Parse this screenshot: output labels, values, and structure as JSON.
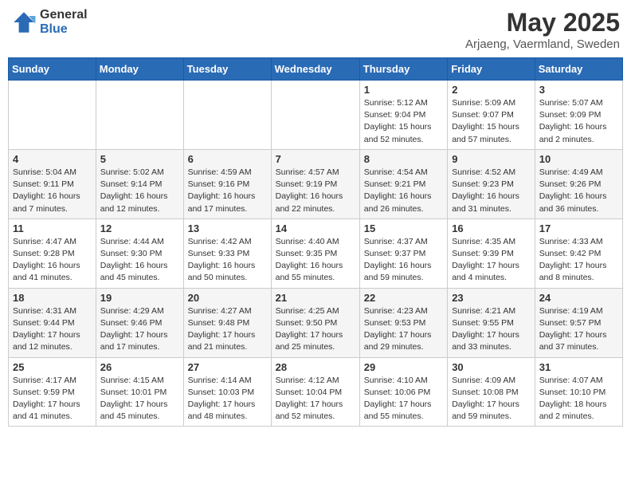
{
  "header": {
    "logo_general": "General",
    "logo_blue": "Blue",
    "title": "May 2025",
    "subtitle": "Arjaeng, Vaermland, Sweden"
  },
  "days_of_week": [
    "Sunday",
    "Monday",
    "Tuesday",
    "Wednesday",
    "Thursday",
    "Friday",
    "Saturday"
  ],
  "weeks": [
    [
      {
        "day": "",
        "info": ""
      },
      {
        "day": "",
        "info": ""
      },
      {
        "day": "",
        "info": ""
      },
      {
        "day": "",
        "info": ""
      },
      {
        "day": "1",
        "info": "Sunrise: 5:12 AM\nSunset: 9:04 PM\nDaylight: 15 hours\nand 52 minutes."
      },
      {
        "day": "2",
        "info": "Sunrise: 5:09 AM\nSunset: 9:07 PM\nDaylight: 15 hours\nand 57 minutes."
      },
      {
        "day": "3",
        "info": "Sunrise: 5:07 AM\nSunset: 9:09 PM\nDaylight: 16 hours\nand 2 minutes."
      }
    ],
    [
      {
        "day": "4",
        "info": "Sunrise: 5:04 AM\nSunset: 9:11 PM\nDaylight: 16 hours\nand 7 minutes."
      },
      {
        "day": "5",
        "info": "Sunrise: 5:02 AM\nSunset: 9:14 PM\nDaylight: 16 hours\nand 12 minutes."
      },
      {
        "day": "6",
        "info": "Sunrise: 4:59 AM\nSunset: 9:16 PM\nDaylight: 16 hours\nand 17 minutes."
      },
      {
        "day": "7",
        "info": "Sunrise: 4:57 AM\nSunset: 9:19 PM\nDaylight: 16 hours\nand 22 minutes."
      },
      {
        "day": "8",
        "info": "Sunrise: 4:54 AM\nSunset: 9:21 PM\nDaylight: 16 hours\nand 26 minutes."
      },
      {
        "day": "9",
        "info": "Sunrise: 4:52 AM\nSunset: 9:23 PM\nDaylight: 16 hours\nand 31 minutes."
      },
      {
        "day": "10",
        "info": "Sunrise: 4:49 AM\nSunset: 9:26 PM\nDaylight: 16 hours\nand 36 minutes."
      }
    ],
    [
      {
        "day": "11",
        "info": "Sunrise: 4:47 AM\nSunset: 9:28 PM\nDaylight: 16 hours\nand 41 minutes."
      },
      {
        "day": "12",
        "info": "Sunrise: 4:44 AM\nSunset: 9:30 PM\nDaylight: 16 hours\nand 45 minutes."
      },
      {
        "day": "13",
        "info": "Sunrise: 4:42 AM\nSunset: 9:33 PM\nDaylight: 16 hours\nand 50 minutes."
      },
      {
        "day": "14",
        "info": "Sunrise: 4:40 AM\nSunset: 9:35 PM\nDaylight: 16 hours\nand 55 minutes."
      },
      {
        "day": "15",
        "info": "Sunrise: 4:37 AM\nSunset: 9:37 PM\nDaylight: 16 hours\nand 59 minutes."
      },
      {
        "day": "16",
        "info": "Sunrise: 4:35 AM\nSunset: 9:39 PM\nDaylight: 17 hours\nand 4 minutes."
      },
      {
        "day": "17",
        "info": "Sunrise: 4:33 AM\nSunset: 9:42 PM\nDaylight: 17 hours\nand 8 minutes."
      }
    ],
    [
      {
        "day": "18",
        "info": "Sunrise: 4:31 AM\nSunset: 9:44 PM\nDaylight: 17 hours\nand 12 minutes."
      },
      {
        "day": "19",
        "info": "Sunrise: 4:29 AM\nSunset: 9:46 PM\nDaylight: 17 hours\nand 17 minutes."
      },
      {
        "day": "20",
        "info": "Sunrise: 4:27 AM\nSunset: 9:48 PM\nDaylight: 17 hours\nand 21 minutes."
      },
      {
        "day": "21",
        "info": "Sunrise: 4:25 AM\nSunset: 9:50 PM\nDaylight: 17 hours\nand 25 minutes."
      },
      {
        "day": "22",
        "info": "Sunrise: 4:23 AM\nSunset: 9:53 PM\nDaylight: 17 hours\nand 29 minutes."
      },
      {
        "day": "23",
        "info": "Sunrise: 4:21 AM\nSunset: 9:55 PM\nDaylight: 17 hours\nand 33 minutes."
      },
      {
        "day": "24",
        "info": "Sunrise: 4:19 AM\nSunset: 9:57 PM\nDaylight: 17 hours\nand 37 minutes."
      }
    ],
    [
      {
        "day": "25",
        "info": "Sunrise: 4:17 AM\nSunset: 9:59 PM\nDaylight: 17 hours\nand 41 minutes."
      },
      {
        "day": "26",
        "info": "Sunrise: 4:15 AM\nSunset: 10:01 PM\nDaylight: 17 hours\nand 45 minutes."
      },
      {
        "day": "27",
        "info": "Sunrise: 4:14 AM\nSunset: 10:03 PM\nDaylight: 17 hours\nand 48 minutes."
      },
      {
        "day": "28",
        "info": "Sunrise: 4:12 AM\nSunset: 10:04 PM\nDaylight: 17 hours\nand 52 minutes."
      },
      {
        "day": "29",
        "info": "Sunrise: 4:10 AM\nSunset: 10:06 PM\nDaylight: 17 hours\nand 55 minutes."
      },
      {
        "day": "30",
        "info": "Sunrise: 4:09 AM\nSunset: 10:08 PM\nDaylight: 17 hours\nand 59 minutes."
      },
      {
        "day": "31",
        "info": "Sunrise: 4:07 AM\nSunset: 10:10 PM\nDaylight: 18 hours\nand 2 minutes."
      }
    ]
  ]
}
